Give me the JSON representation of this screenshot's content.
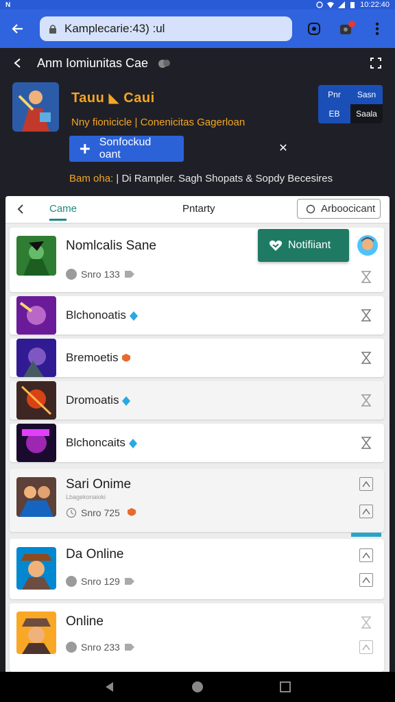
{
  "status_bar": {
    "left": "N",
    "time": "10:22:40"
  },
  "browser": {
    "url": "Kamplecarie:43) :ul"
  },
  "header": {
    "title": "Anm Iomiunitas Cae",
    "game_name": "Tauu ◣ Caui",
    "game_subtitle": "Nny fionicicle | Conenicitas Gagerloan",
    "btn_top_left": "Pnr",
    "btn_top_right": "Sasn",
    "btn_bottom_left": "EB",
    "btn_bottom_right": "Saala",
    "cta_label": "Sonfockud oant",
    "footer_highlight": "Bam oha:",
    "footer_text": " | Di Rampler. Sagh Shopats & Sopdy Becesires"
  },
  "tabs": {
    "game": "Came",
    "priority": "Pntarty",
    "advanced": "Arboocicant"
  },
  "notification": {
    "label": "Notifiiant"
  },
  "games": [
    {
      "name": "Nomlcalis Sane",
      "stat": "Snro 133"
    },
    {
      "name": "Blchonoatis"
    },
    {
      "name": "Bremoetis"
    },
    {
      "name": "Dromoatis"
    },
    {
      "name": "Blchoncaits"
    },
    {
      "name": "Sari Onime",
      "sub": "Lbagekonaioki",
      "stat": "Snro 725"
    },
    {
      "name": "Da Online",
      "stat": "Snro 129"
    },
    {
      "name": "Online",
      "stat": "Snro 233"
    }
  ],
  "colors": {
    "accent_blue": "#2f64de",
    "teal": "#1b8a84",
    "notif_green": "#1e7a63",
    "gold": "#f5a623"
  }
}
